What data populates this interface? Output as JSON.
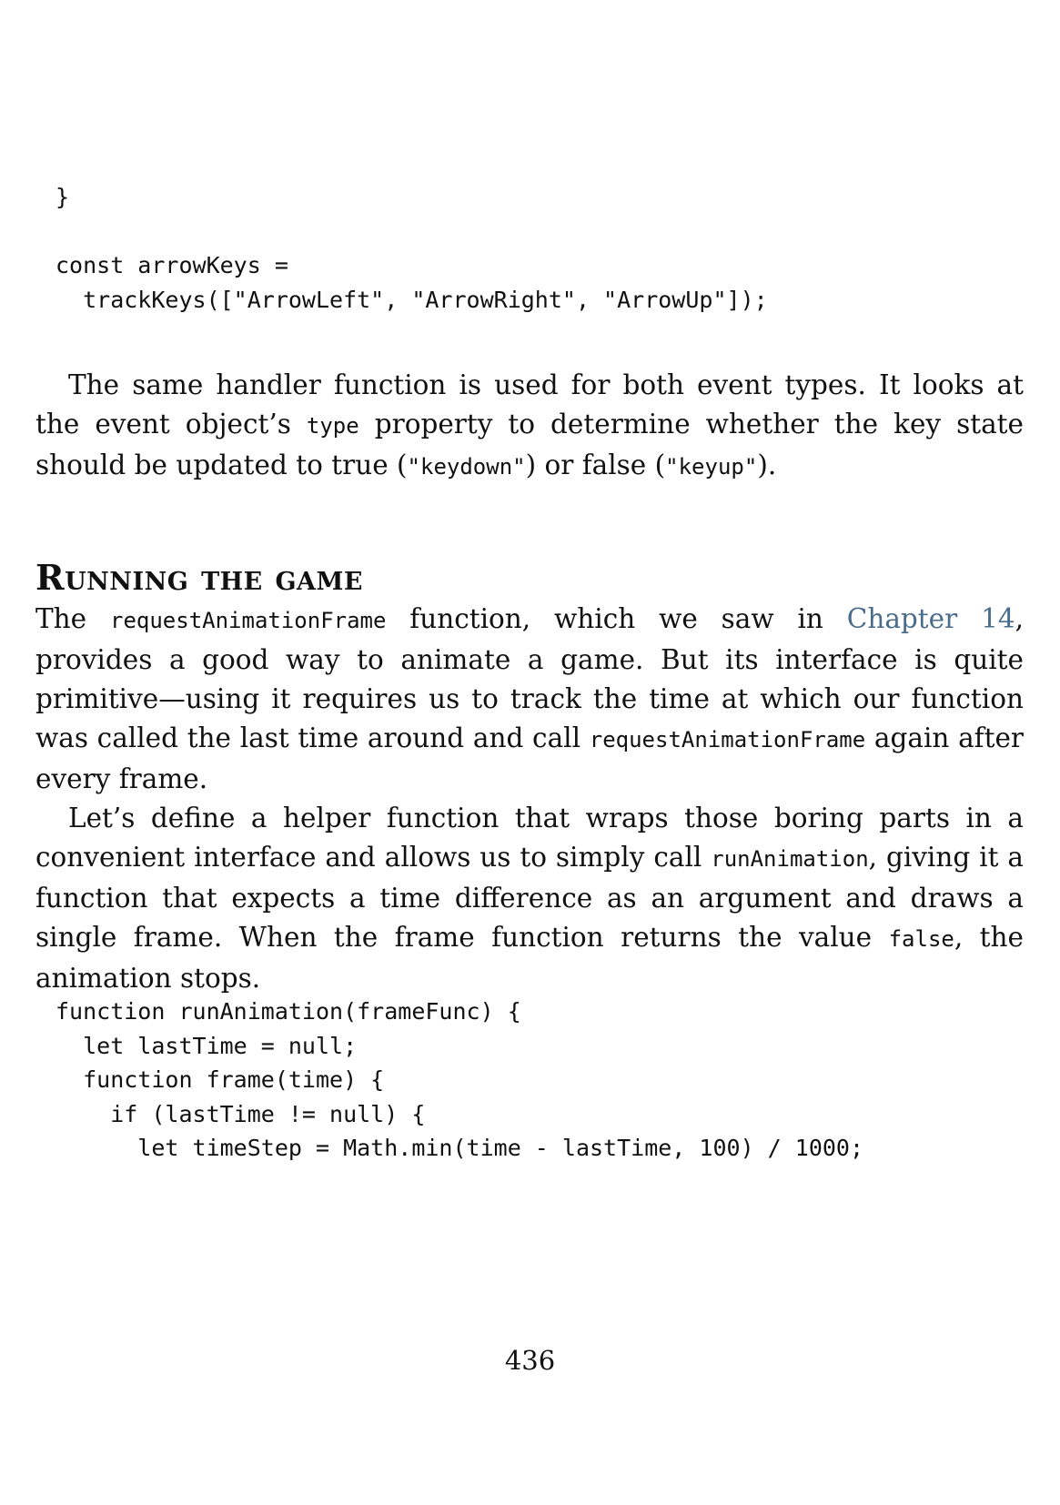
{
  "code_block_1": {
    "lines": [
      "}",
      "",
      "const arrowKeys =",
      "  trackKeys([\"ArrowLeft\", \"ArrowRight\", \"ArrowUp\"]);"
    ]
  },
  "paragraph_1": {
    "t1": "The same handler function is used for both event types. It looks at the event object’s ",
    "c1": "type",
    "t2": " property to determine whether the key state should be updated to true (",
    "c2": "\"keydown\"",
    "t3": ") or false (",
    "c3": "\"keyup\"",
    "t4": ")."
  },
  "section": {
    "heading": "Running the game"
  },
  "paragraph_2": {
    "t1": "The ",
    "c1": "requestAnimationFrame",
    "t2": " function, which we saw in ",
    "link": "Chapter 14",
    "t3": ", provides a good way to animate a game. But its interface is quite primitive—using it requires us to track the time at which our function was called the last time around and call ",
    "c2": "requestAnimationFrame",
    "t4": " again after every frame."
  },
  "paragraph_3": {
    "t1": "Let’s define a helper function that wraps those boring parts in a convenient interface and allows us to simply call ",
    "c1": "runAnimation",
    "t2": ", giving it a function that expects a time difference as an argument and draws a single frame. When the frame function returns the value ",
    "c2": "false",
    "t3": ", the animation stops."
  },
  "code_block_2": {
    "lines": [
      "function runAnimation(frameFunc) {",
      "  let lastTime = null;",
      "  function frame(time) {",
      "    if (lastTime != null) {",
      "      let timeStep = Math.min(time - lastTime, 100) / 1000;"
    ]
  },
  "footer": {
    "page_number": "436"
  }
}
